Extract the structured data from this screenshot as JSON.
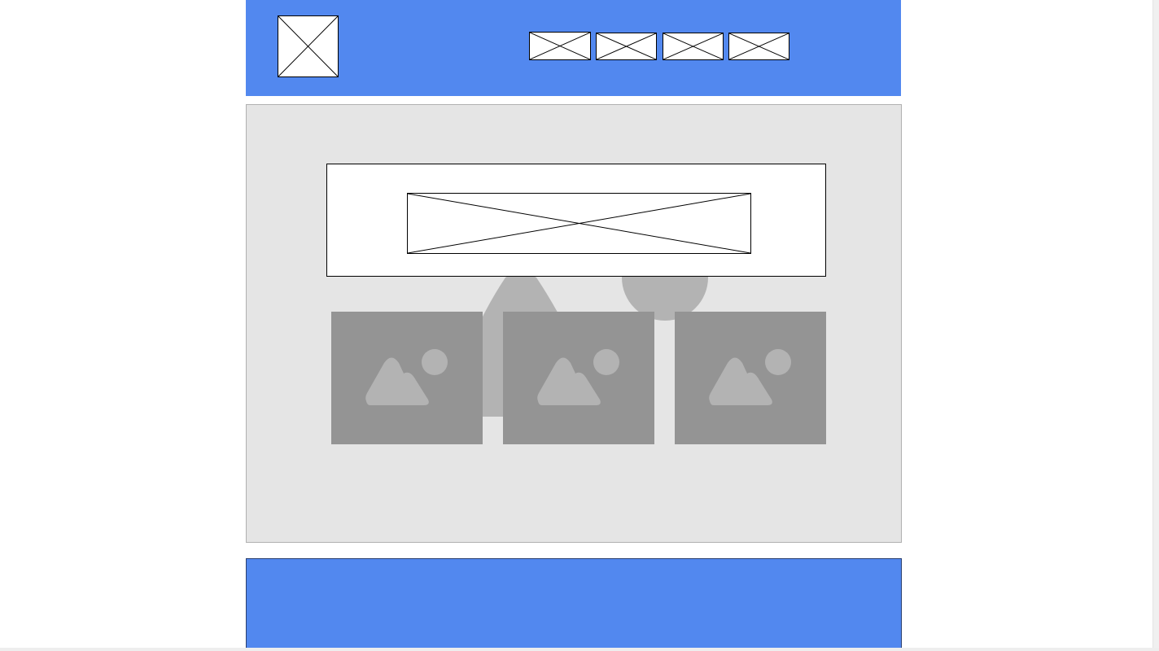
{
  "page": {
    "title": ""
  },
  "colors": {
    "header_bg": "#5288ef",
    "footer_bg": "#5288ef",
    "content_bg": "#e5e5e5",
    "image_card_bg": "#949494",
    "image_glyph": "#b3b3b3",
    "placeholder_fill": "#ffffff",
    "placeholder_stroke": "#000000"
  },
  "header": {
    "logo_icon": "image-placeholder-icon",
    "nav_items": [
      {
        "icon": "image-placeholder-icon"
      },
      {
        "icon": "image-placeholder-icon"
      },
      {
        "icon": "image-placeholder-icon"
      },
      {
        "icon": "image-placeholder-icon"
      }
    ]
  },
  "main": {
    "background_art": "landscape-illustration",
    "banner": {
      "image_icon": "image-placeholder-icon"
    },
    "cards": [
      {
        "icon": "landscape-image-icon"
      },
      {
        "icon": "landscape-image-icon"
      },
      {
        "icon": "landscape-image-icon"
      }
    ]
  },
  "footer": {}
}
